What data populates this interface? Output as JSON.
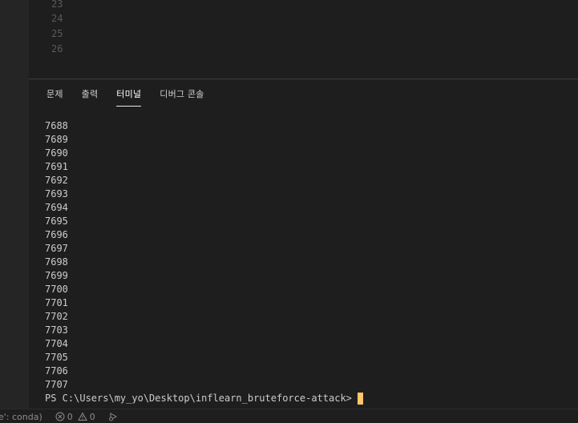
{
  "editor": {
    "line_numbers": [
      "23",
      "24",
      "25",
      "26"
    ]
  },
  "panel": {
    "tabs": [
      {
        "label": "문제",
        "active": false
      },
      {
        "label": "출력",
        "active": false
      },
      {
        "label": "터미널",
        "active": true
      },
      {
        "label": "디버그 콘솔",
        "active": false
      }
    ]
  },
  "terminal": {
    "output_lines": [
      "7688",
      "7689",
      "7690",
      "7691",
      "7692",
      "7693",
      "7694",
      "7695",
      "7696",
      "7697",
      "7698",
      "7699",
      "7700",
      "7701",
      "7702",
      "7703",
      "7704",
      "7705",
      "7706",
      "7707"
    ],
    "prompt": "PS C:\\Users\\my_yo\\Desktop\\inflearn_bruteforce-attack>",
    "cursor_color": "#ffc66d"
  },
  "statusbar": {
    "env_text": "e': conda)",
    "errors": "0",
    "warnings": "0",
    "error_icon": "error-circle-icon",
    "warning_icon": "warning-triangle-icon",
    "run_icon": "run-debug-icon"
  },
  "colors": {
    "background": "#1e1e1e",
    "activity_bar": "#252526",
    "text": "#cccccc",
    "line_number": "#5a5a5a"
  }
}
